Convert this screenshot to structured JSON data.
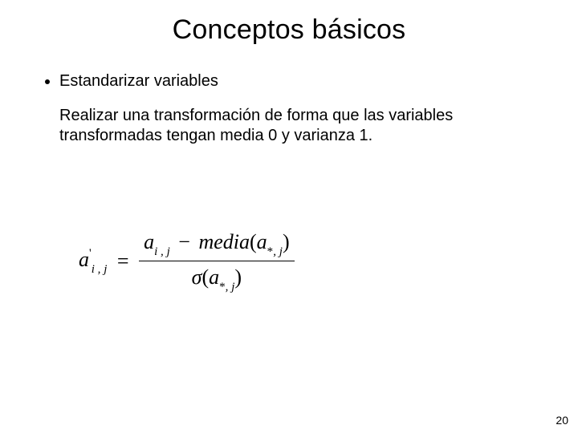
{
  "title": "Conceptos básicos",
  "bullet": "Estandarizar variables",
  "description": "Realizar una transformación de forma que las variables transformadas tengan media 0 y varianza 1.",
  "formula": {
    "lhs_base": "a",
    "lhs_sub": "i , j",
    "lhs_prime": "'",
    "eq": "=",
    "num_a": "a",
    "num_a_sub": "i , j",
    "minus": "−",
    "media": "media",
    "lparen": "(",
    "rparen": ")",
    "arg_a": "a",
    "arg_sub": "*, j",
    "sigma": "σ",
    "den_a": "a",
    "den_sub": "*, j"
  },
  "page_number": "20"
}
